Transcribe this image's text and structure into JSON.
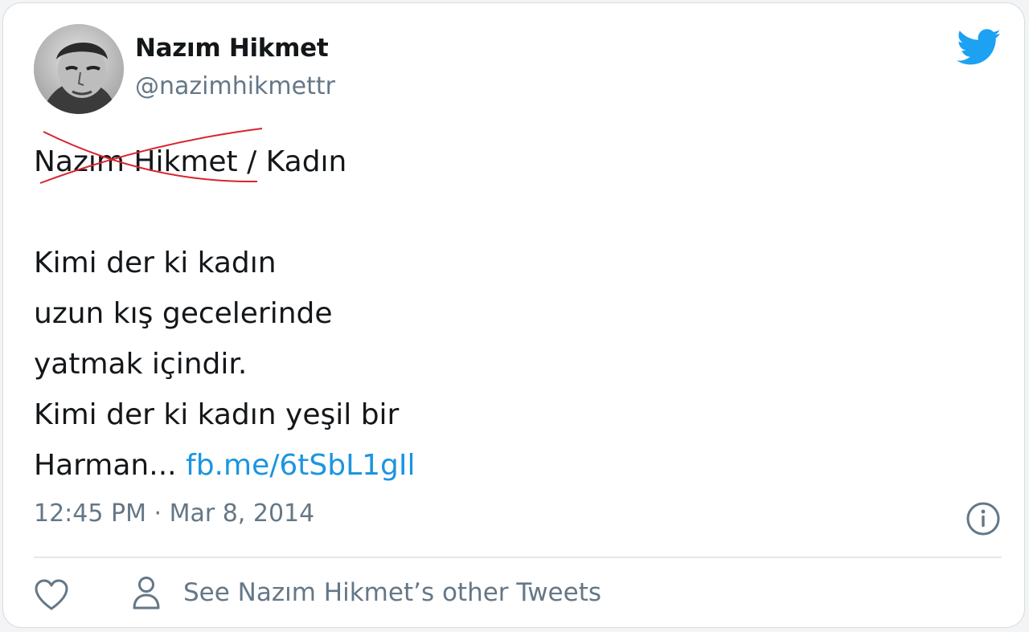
{
  "tweet": {
    "author_name": "Nazım Hikmet",
    "author_handle": "@nazimhikmettr",
    "title_struck": "Nazım Hikmet",
    "title_rest": " / Kadın",
    "lines": [
      "Kimi der ki kadın",
      "uzun kış gecelerinde",
      "yatmak içindir.",
      "Kimi der ki kadın yeşil bir"
    ],
    "last_line_text": "Harman... ",
    "link_text": "fb.me/6tSbL1gIl",
    "timestamp": "12:45 PM · Mar 8, 2014"
  },
  "actions": {
    "other_tweets_label": "See Nazım Hikmet’s other Tweets"
  },
  "icons": {
    "brand": "twitter-bird-icon",
    "info": "info-icon",
    "like": "heart-icon",
    "profile": "person-icon"
  },
  "colors": {
    "brand_blue": "#1da1f2",
    "link_blue": "#1b95e0",
    "secondary_text": "#657786",
    "strike_red": "#d9232e"
  }
}
